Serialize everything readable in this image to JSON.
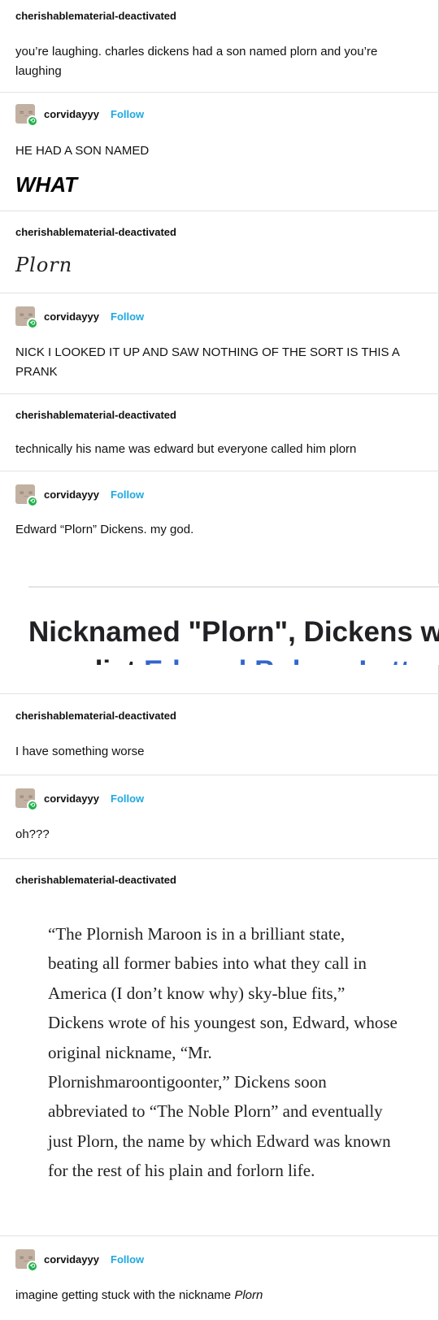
{
  "users": {
    "op": "cherishablematerial-deactivated",
    "reblogger": "corvidayyy",
    "follow_label": "Follow"
  },
  "posts": [
    {
      "text": "you’re laughing. charles dickens had a son named plorn and you’re laughing"
    },
    {
      "text": "HE HAD A SON NAMED",
      "emphasis": "WHAT"
    },
    {
      "script": "Plorn"
    },
    {
      "text": "NICK I LOOKED IT UP AND SAW NOTHING OF THE SORT IS THIS A PRANK"
    },
    {
      "text": "technically his name was edward but everyone called him plorn"
    },
    {
      "text": "Edward “Plorn” Dickens. my god."
    },
    {
      "text": "I have something worse"
    },
    {
      "text": "oh???"
    },
    {
      "text": "“The Plornish Maroon is in a brilliant state, beating all former babies into what they call in America (I don’t know why) sky-blue fits,” Dickens wrote of his youngest son, Edward, whose original nickname, “Mr. Plornishmaroontigoonter,” Dickens soon abbreviated to “The Noble Plorn” and eventually just Plorn, the name by which Edward was known for the rest of his plain and forlorn life."
    },
    {
      "text_prefix": "imagine getting stuck with the nickname ",
      "text_italic": "Plorn"
    }
  ],
  "screenshot": {
    "headline": "Nicknamed \"Plorn\", Dickens w",
    "sub_prefix": "novelist ",
    "sub_link": "Edward Bulwer-Lytto"
  },
  "colors": {
    "follow": "#1fa8e0",
    "reblog_badge": "#22b14c",
    "link": "#3366cc"
  },
  "icons": {
    "avatar": "avatar-icon",
    "reblog": "reblog-icon"
  }
}
